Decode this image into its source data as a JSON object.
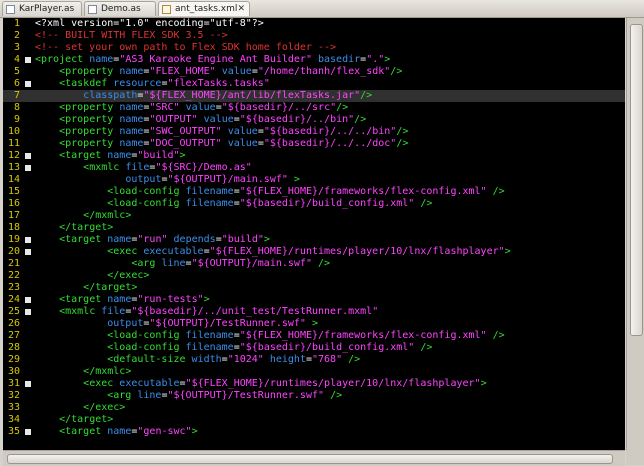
{
  "tabs": [
    {
      "label": "KarPlayer.as",
      "close": "",
      "active": false,
      "type": "as"
    },
    {
      "label": "Demo.as",
      "close": "",
      "active": false,
      "type": "as"
    },
    {
      "label": "ant_tasks.xml",
      "close": "✕",
      "active": true,
      "type": "xml"
    }
  ],
  "colors": {
    "background": "#000000",
    "text": "#ffffff",
    "line_number": "#d8c800",
    "tag": "#33dd33",
    "attribute": "#3b8eea",
    "string": "#ff44ff",
    "comment": "#dd3333",
    "highlight_line": "#303030"
  },
  "editor": {
    "highlighted_line": 7,
    "lines": [
      {
        "n": "1",
        "fold": false,
        "s": [
          [
            "t",
            "<?xml version=\"1.0\" encoding=\"utf-8\"?>"
          ]
        ]
      },
      {
        "n": "2",
        "fold": false,
        "s": [
          [
            "c",
            "<!-- BUILT WITH FLEX SDK 3.5 -->"
          ]
        ]
      },
      {
        "n": "3",
        "fold": false,
        "s": [
          [
            "c",
            "<!-- set your own path to Flex SDK home folder -->"
          ]
        ]
      },
      {
        "n": "4",
        "fold": true,
        "s": [
          [
            "g",
            "<project "
          ],
          [
            "a",
            "name"
          ],
          [
            "p",
            "="
          ],
          [
            "s",
            "\"AS3 Karaoke Engine Ant Builder\""
          ],
          [
            "p",
            " "
          ],
          [
            "a",
            "basedir"
          ],
          [
            "p",
            "="
          ],
          [
            "s",
            "\".\""
          ],
          [
            "g",
            ">"
          ]
        ]
      },
      {
        "n": "5",
        "fold": false,
        "s": [
          [
            "p",
            "    "
          ],
          [
            "g",
            "<property "
          ],
          [
            "a",
            "name"
          ],
          [
            "p",
            "="
          ],
          [
            "s",
            "\"FLEX_HOME\""
          ],
          [
            "p",
            " "
          ],
          [
            "a",
            "value"
          ],
          [
            "p",
            "="
          ],
          [
            "s",
            "\"/home/thanh/flex_sdk\""
          ],
          [
            "g",
            "/>"
          ]
        ]
      },
      {
        "n": "6",
        "fold": true,
        "s": [
          [
            "p",
            "    "
          ],
          [
            "g",
            "<taskdef "
          ],
          [
            "a",
            "resource"
          ],
          [
            "p",
            "="
          ],
          [
            "s",
            "\"flexTasks.tasks\""
          ]
        ]
      },
      {
        "n": "7",
        "fold": false,
        "s": [
          [
            "p",
            "        "
          ],
          [
            "a",
            "classpath"
          ],
          [
            "p",
            "="
          ],
          [
            "s",
            "\"${FLEX_HOME}/ant/lib/flexTasks.jar\""
          ],
          [
            "g",
            "/>"
          ]
        ]
      },
      {
        "n": "8",
        "fold": false,
        "s": [
          [
            "p",
            "    "
          ],
          [
            "g",
            "<property "
          ],
          [
            "a",
            "name"
          ],
          [
            "p",
            "="
          ],
          [
            "s",
            "\"SRC\""
          ],
          [
            "p",
            " "
          ],
          [
            "a",
            "value"
          ],
          [
            "p",
            "="
          ],
          [
            "s",
            "\"${basedir}/../src\""
          ],
          [
            "g",
            "/>"
          ]
        ]
      },
      {
        "n": "9",
        "fold": false,
        "s": [
          [
            "p",
            "    "
          ],
          [
            "g",
            "<property "
          ],
          [
            "a",
            "name"
          ],
          [
            "p",
            "="
          ],
          [
            "s",
            "\"OUTPUT\""
          ],
          [
            "p",
            " "
          ],
          [
            "a",
            "value"
          ],
          [
            "p",
            "="
          ],
          [
            "s",
            "\"${basedir}/../bin\""
          ],
          [
            "g",
            "/>"
          ]
        ]
      },
      {
        "n": "10",
        "fold": false,
        "s": [
          [
            "p",
            "    "
          ],
          [
            "g",
            "<property "
          ],
          [
            "a",
            "name"
          ],
          [
            "p",
            "="
          ],
          [
            "s",
            "\"SWC_OUTPUT\""
          ],
          [
            "p",
            " "
          ],
          [
            "a",
            "value"
          ],
          [
            "p",
            "="
          ],
          [
            "s",
            "\"${basedir}/../../bin\""
          ],
          [
            "g",
            "/>"
          ]
        ]
      },
      {
        "n": "11",
        "fold": false,
        "s": [
          [
            "p",
            "    "
          ],
          [
            "g",
            "<property "
          ],
          [
            "a",
            "name"
          ],
          [
            "p",
            "="
          ],
          [
            "s",
            "\"DOC_OUTPUT\""
          ],
          [
            "p",
            " "
          ],
          [
            "a",
            "value"
          ],
          [
            "p",
            "="
          ],
          [
            "s",
            "\"${basedir}/../../doc\""
          ],
          [
            "g",
            "/>"
          ]
        ]
      },
      {
        "n": "12",
        "fold": true,
        "s": [
          [
            "p",
            "    "
          ],
          [
            "g",
            "<target "
          ],
          [
            "a",
            "name"
          ],
          [
            "p",
            "="
          ],
          [
            "s",
            "\"build\""
          ],
          [
            "g",
            ">"
          ]
        ]
      },
      {
        "n": "13",
        "fold": true,
        "s": [
          [
            "p",
            "        "
          ],
          [
            "g",
            "<mxmlc "
          ],
          [
            "a",
            "file"
          ],
          [
            "p",
            "="
          ],
          [
            "s",
            "\"${SRC}/Demo.as\""
          ]
        ]
      },
      {
        "n": "14",
        "fold": false,
        "s": [
          [
            "p",
            "               "
          ],
          [
            "a",
            "output"
          ],
          [
            "p",
            "="
          ],
          [
            "s",
            "\"${OUTPUT}/main.swf\""
          ],
          [
            "p",
            " "
          ],
          [
            "g",
            ">"
          ]
        ]
      },
      {
        "n": "15",
        "fold": false,
        "s": [
          [
            "p",
            "            "
          ],
          [
            "g",
            "<load-config "
          ],
          [
            "a",
            "filename"
          ],
          [
            "p",
            "="
          ],
          [
            "s",
            "\"${FLEX_HOME}/frameworks/flex-config.xml\""
          ],
          [
            "p",
            " "
          ],
          [
            "g",
            "/>"
          ]
        ]
      },
      {
        "n": "16",
        "fold": false,
        "s": [
          [
            "p",
            "            "
          ],
          [
            "g",
            "<load-config "
          ],
          [
            "a",
            "filename"
          ],
          [
            "p",
            "="
          ],
          [
            "s",
            "\"${basedir}/build_config.xml\""
          ],
          [
            "p",
            " "
          ],
          [
            "g",
            "/>"
          ]
        ]
      },
      {
        "n": "17",
        "fold": false,
        "s": [
          [
            "p",
            "        "
          ],
          [
            "g",
            "</mxmlc>"
          ]
        ]
      },
      {
        "n": "18",
        "fold": false,
        "s": [
          [
            "p",
            "    "
          ],
          [
            "g",
            "</target>"
          ]
        ]
      },
      {
        "n": "19",
        "fold": true,
        "s": [
          [
            "p",
            "    "
          ],
          [
            "g",
            "<target "
          ],
          [
            "a",
            "name"
          ],
          [
            "p",
            "="
          ],
          [
            "s",
            "\"run\""
          ],
          [
            "p",
            " "
          ],
          [
            "a",
            "depends"
          ],
          [
            "p",
            "="
          ],
          [
            "s",
            "\"build\""
          ],
          [
            "g",
            ">"
          ]
        ]
      },
      {
        "n": "20",
        "fold": true,
        "s": [
          [
            "p",
            "            "
          ],
          [
            "g",
            "<exec "
          ],
          [
            "a",
            "executable"
          ],
          [
            "p",
            "="
          ],
          [
            "s",
            "\"${FLEX_HOME}/runtimes/player/10/lnx/flashplayer\""
          ],
          [
            "g",
            ">"
          ]
        ]
      },
      {
        "n": "21",
        "fold": false,
        "s": [
          [
            "p",
            "                "
          ],
          [
            "g",
            "<arg "
          ],
          [
            "a",
            "line"
          ],
          [
            "p",
            "="
          ],
          [
            "s",
            "\"${OUTPUT}/main.swf\""
          ],
          [
            "p",
            " "
          ],
          [
            "g",
            "/>"
          ]
        ]
      },
      {
        "n": "22",
        "fold": false,
        "s": [
          [
            "p",
            "            "
          ],
          [
            "g",
            "</exec>"
          ]
        ]
      },
      {
        "n": "23",
        "fold": false,
        "s": [
          [
            "p",
            "        "
          ],
          [
            "g",
            "</target>"
          ]
        ]
      },
      {
        "n": "24",
        "fold": true,
        "s": [
          [
            "p",
            "    "
          ],
          [
            "g",
            "<target "
          ],
          [
            "a",
            "name"
          ],
          [
            "p",
            "="
          ],
          [
            "s",
            "\"run-tests\""
          ],
          [
            "g",
            ">"
          ]
        ]
      },
      {
        "n": "25",
        "fold": true,
        "s": [
          [
            "p",
            "    "
          ],
          [
            "g",
            "<mxmlc "
          ],
          [
            "a",
            "file"
          ],
          [
            "p",
            "="
          ],
          [
            "s",
            "\"${basedir}/../unit_test/TestRunner.mxml\""
          ]
        ]
      },
      {
        "n": "26",
        "fold": false,
        "s": [
          [
            "p",
            "            "
          ],
          [
            "a",
            "output"
          ],
          [
            "p",
            "="
          ],
          [
            "s",
            "\"${OUTPUT}/TestRunner.swf\""
          ],
          [
            "p",
            " "
          ],
          [
            "g",
            ">"
          ]
        ]
      },
      {
        "n": "27",
        "fold": false,
        "s": [
          [
            "p",
            "            "
          ],
          [
            "g",
            "<load-config "
          ],
          [
            "a",
            "filename"
          ],
          [
            "p",
            "="
          ],
          [
            "s",
            "\"${FLEX_HOME}/frameworks/flex-config.xml\""
          ],
          [
            "p",
            " "
          ],
          [
            "g",
            "/>"
          ]
        ]
      },
      {
        "n": "28",
        "fold": false,
        "s": [
          [
            "p",
            "            "
          ],
          [
            "g",
            "<load-config "
          ],
          [
            "a",
            "filename"
          ],
          [
            "p",
            "="
          ],
          [
            "s",
            "\"${basedir}/build_config.xml\""
          ],
          [
            "p",
            " "
          ],
          [
            "g",
            "/>"
          ]
        ]
      },
      {
        "n": "29",
        "fold": false,
        "s": [
          [
            "p",
            "            "
          ],
          [
            "g",
            "<default-size "
          ],
          [
            "a",
            "width"
          ],
          [
            "p",
            "="
          ],
          [
            "s",
            "\"1024\""
          ],
          [
            "p",
            " "
          ],
          [
            "a",
            "height"
          ],
          [
            "p",
            "="
          ],
          [
            "s",
            "\"768\""
          ],
          [
            "p",
            " "
          ],
          [
            "g",
            "/>"
          ]
        ]
      },
      {
        "n": "30",
        "fold": false,
        "s": [
          [
            "p",
            "        "
          ],
          [
            "g",
            "</mxmlc>"
          ]
        ]
      },
      {
        "n": "31",
        "fold": true,
        "s": [
          [
            "p",
            "        "
          ],
          [
            "g",
            "<exec "
          ],
          [
            "a",
            "executable"
          ],
          [
            "p",
            "="
          ],
          [
            "s",
            "\"${FLEX_HOME}/runtimes/player/10/lnx/flashplayer\""
          ],
          [
            "g",
            ">"
          ]
        ]
      },
      {
        "n": "32",
        "fold": false,
        "s": [
          [
            "p",
            "            "
          ],
          [
            "g",
            "<arg "
          ],
          [
            "a",
            "line"
          ],
          [
            "p",
            "="
          ],
          [
            "s",
            "\"${OUTPUT}/TestRunner.swf\""
          ],
          [
            "p",
            " "
          ],
          [
            "g",
            "/>"
          ]
        ]
      },
      {
        "n": "33",
        "fold": false,
        "s": [
          [
            "p",
            "        "
          ],
          [
            "g",
            "</exec>"
          ]
        ]
      },
      {
        "n": "34",
        "fold": false,
        "s": [
          [
            "p",
            "    "
          ],
          [
            "g",
            "</target>"
          ]
        ]
      },
      {
        "n": "35",
        "fold": true,
        "s": [
          [
            "p",
            "    "
          ],
          [
            "g",
            "<target "
          ],
          [
            "a",
            "name"
          ],
          [
            "p",
            "="
          ],
          [
            "s",
            "\"gen-swc\""
          ],
          [
            "g",
            ">"
          ]
        ]
      }
    ]
  }
}
